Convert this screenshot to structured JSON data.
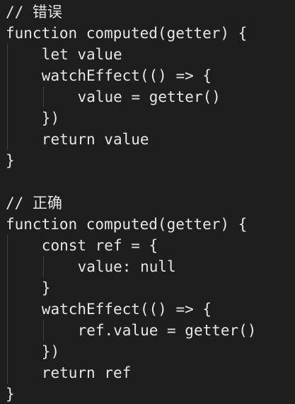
{
  "code": {
    "lines": [
      {
        "indent": 0,
        "text": "// 错误"
      },
      {
        "indent": 0,
        "text": "function computed(getter) {"
      },
      {
        "indent": 1,
        "text": "let value"
      },
      {
        "indent": 1,
        "text": "watchEffect(() => {"
      },
      {
        "indent": 2,
        "text": "value = getter()"
      },
      {
        "indent": 1,
        "text": "})"
      },
      {
        "indent": 1,
        "text": "return value"
      },
      {
        "indent": 0,
        "text": "}"
      },
      {
        "indent": 0,
        "text": ""
      },
      {
        "indent": 0,
        "text": "// 正确"
      },
      {
        "indent": 0,
        "text": "function computed(getter) {"
      },
      {
        "indent": 1,
        "text": "const ref = {"
      },
      {
        "indent": 2,
        "text": "value: null"
      },
      {
        "indent": 1,
        "text": "}"
      },
      {
        "indent": 1,
        "text": "watchEffect(() => {"
      },
      {
        "indent": 2,
        "text": "ref.value = getter()"
      },
      {
        "indent": 1,
        "text": "})"
      },
      {
        "indent": 1,
        "text": "return ref"
      },
      {
        "indent": 0,
        "text": "}"
      }
    ]
  },
  "colors": {
    "background": "#1e1e1e",
    "text": "#e6e6e6",
    "indent_guide": "#3f3f3f"
  }
}
